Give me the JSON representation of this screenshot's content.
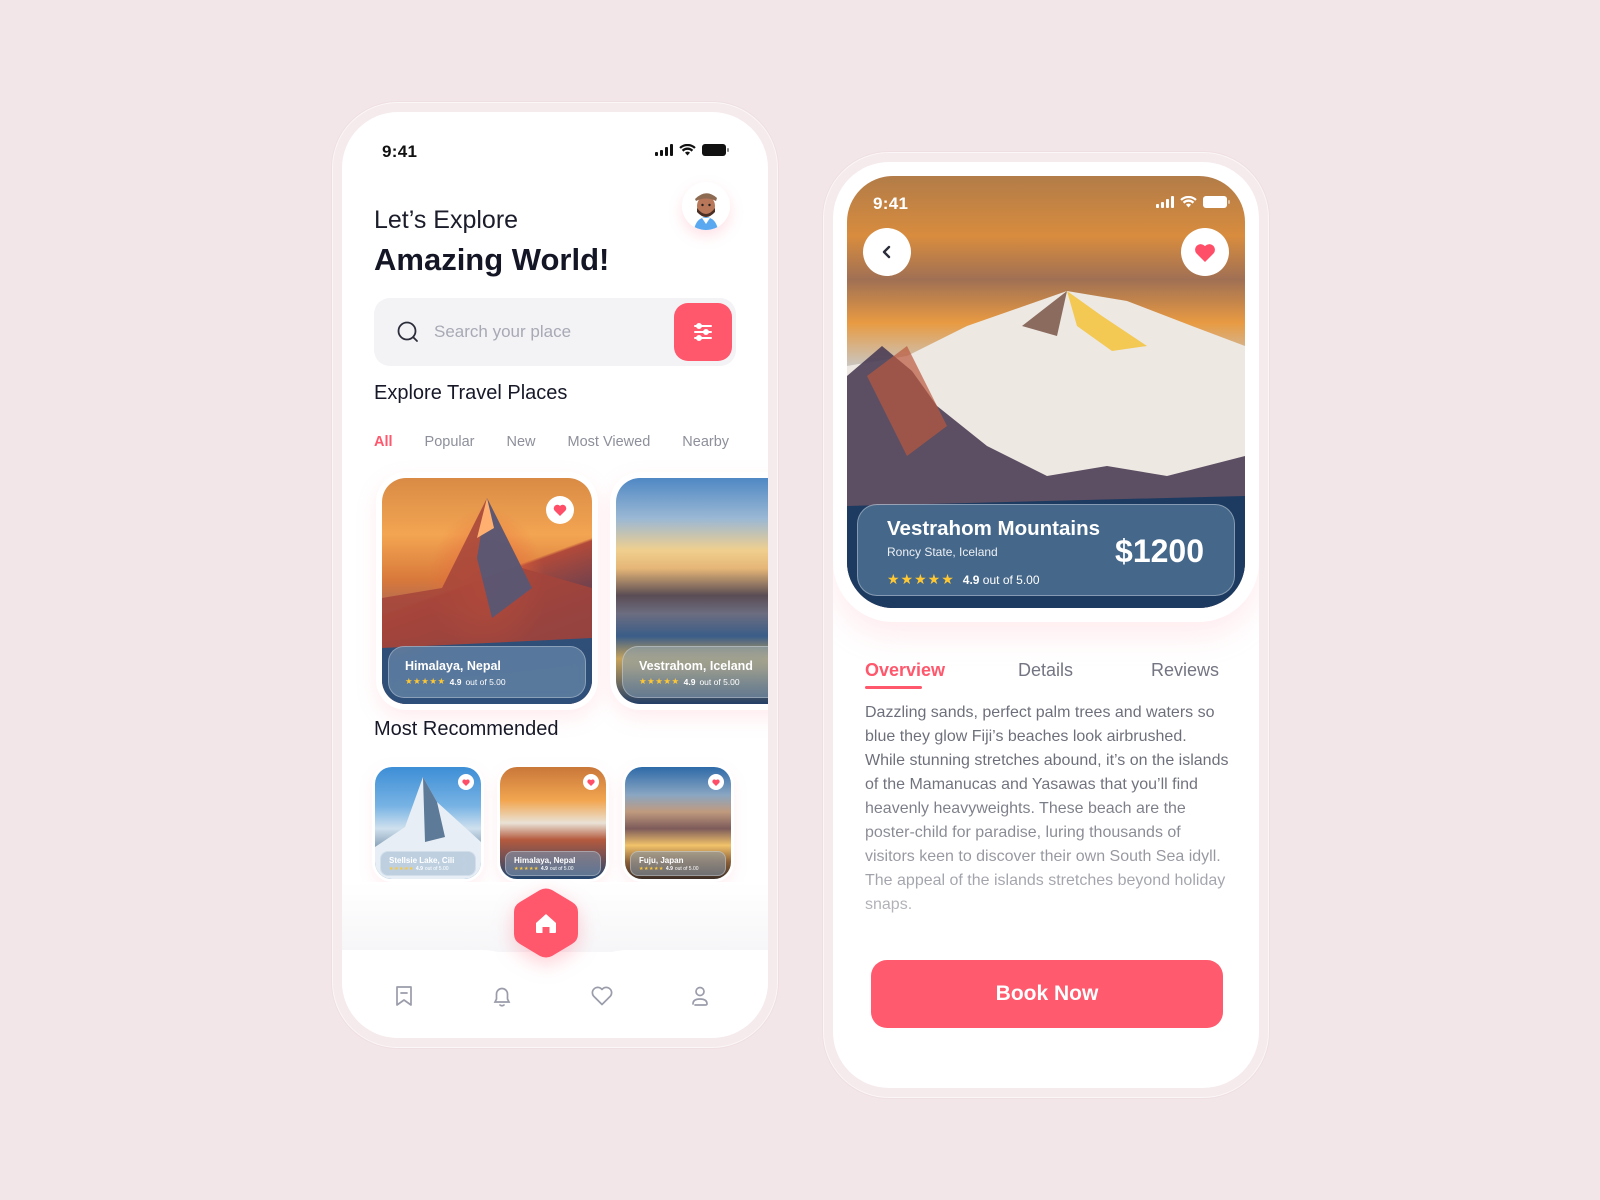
{
  "brand_color": "#ff576c",
  "home_screen": {
    "status": {
      "time": "9:41",
      "icons": [
        "cellular-signal-icon",
        "wifi-icon",
        "battery-icon"
      ]
    },
    "greeting_line1": "Let’s Explore",
    "greeting_line2": "Amazing World!",
    "avatar": "user-avatar",
    "search": {
      "placeholder": "Search your place",
      "value": "",
      "icon": "search-icon",
      "filter_icon": "sliders-icon"
    },
    "explore_title": "Explore Travel Places",
    "filter_tabs": [
      {
        "label": "All",
        "active": true
      },
      {
        "label": "Popular",
        "active": false
      },
      {
        "label": "New",
        "active": false
      },
      {
        "label": "Most Viewed",
        "active": false
      },
      {
        "label": "Nearby",
        "active": false
      }
    ],
    "featured_places": [
      {
        "name": "Himalaya, Nepal",
        "rating": "4.9",
        "rating_suffix": "out of 5.00",
        "favorited": true
      },
      {
        "name": "Vestrahom, Iceland",
        "rating": "4.9",
        "rating_suffix": "out of 5.00",
        "favorited": false
      }
    ],
    "recommended_title": "Most Recommended",
    "recommended_places": [
      {
        "name": "Stellsie Lake, Cili",
        "rating": "4.9",
        "rating_suffix": "out of 5.00",
        "favorited": true
      },
      {
        "name": "Himalaya, Nepal",
        "rating": "4.9",
        "rating_suffix": "out of 5.00",
        "favorited": true
      },
      {
        "name": "Fuju, Japan",
        "rating": "4.9",
        "rating_suffix": "out of 5.00",
        "favorited": true
      }
    ],
    "tab_bar": [
      "bookmark-icon",
      "bell-icon",
      "home-icon",
      "heart-icon",
      "profile-icon"
    ],
    "stars": "★★★★★"
  },
  "detail_screen": {
    "status": {
      "time": "9:41"
    },
    "place_name": "Vestrahom Mountains",
    "location": "Roncy State, Iceland",
    "rating": "4.9",
    "rating_suffix": "out of 5.00",
    "price": "$1200",
    "stars": "★★★★★",
    "tabs": [
      {
        "label": "Overview",
        "active": true
      },
      {
        "label": "Details",
        "active": false
      },
      {
        "label": "Reviews",
        "active": false
      }
    ],
    "overview_text": "Dazzling sands, perfect palm trees and waters so blue they glow Fiji’s beaches look airbrushed. While stunning stretches abound, it’s on the islands of the Mamanucas and Yasawas that you’ll find heavenly heavyweights. These beach are the poster-child for paradise, luring thousands of visitors keen to discover their own South Sea idyll. The appeal of the islands stretches beyond holiday snaps.",
    "book_button": "Book Now"
  }
}
